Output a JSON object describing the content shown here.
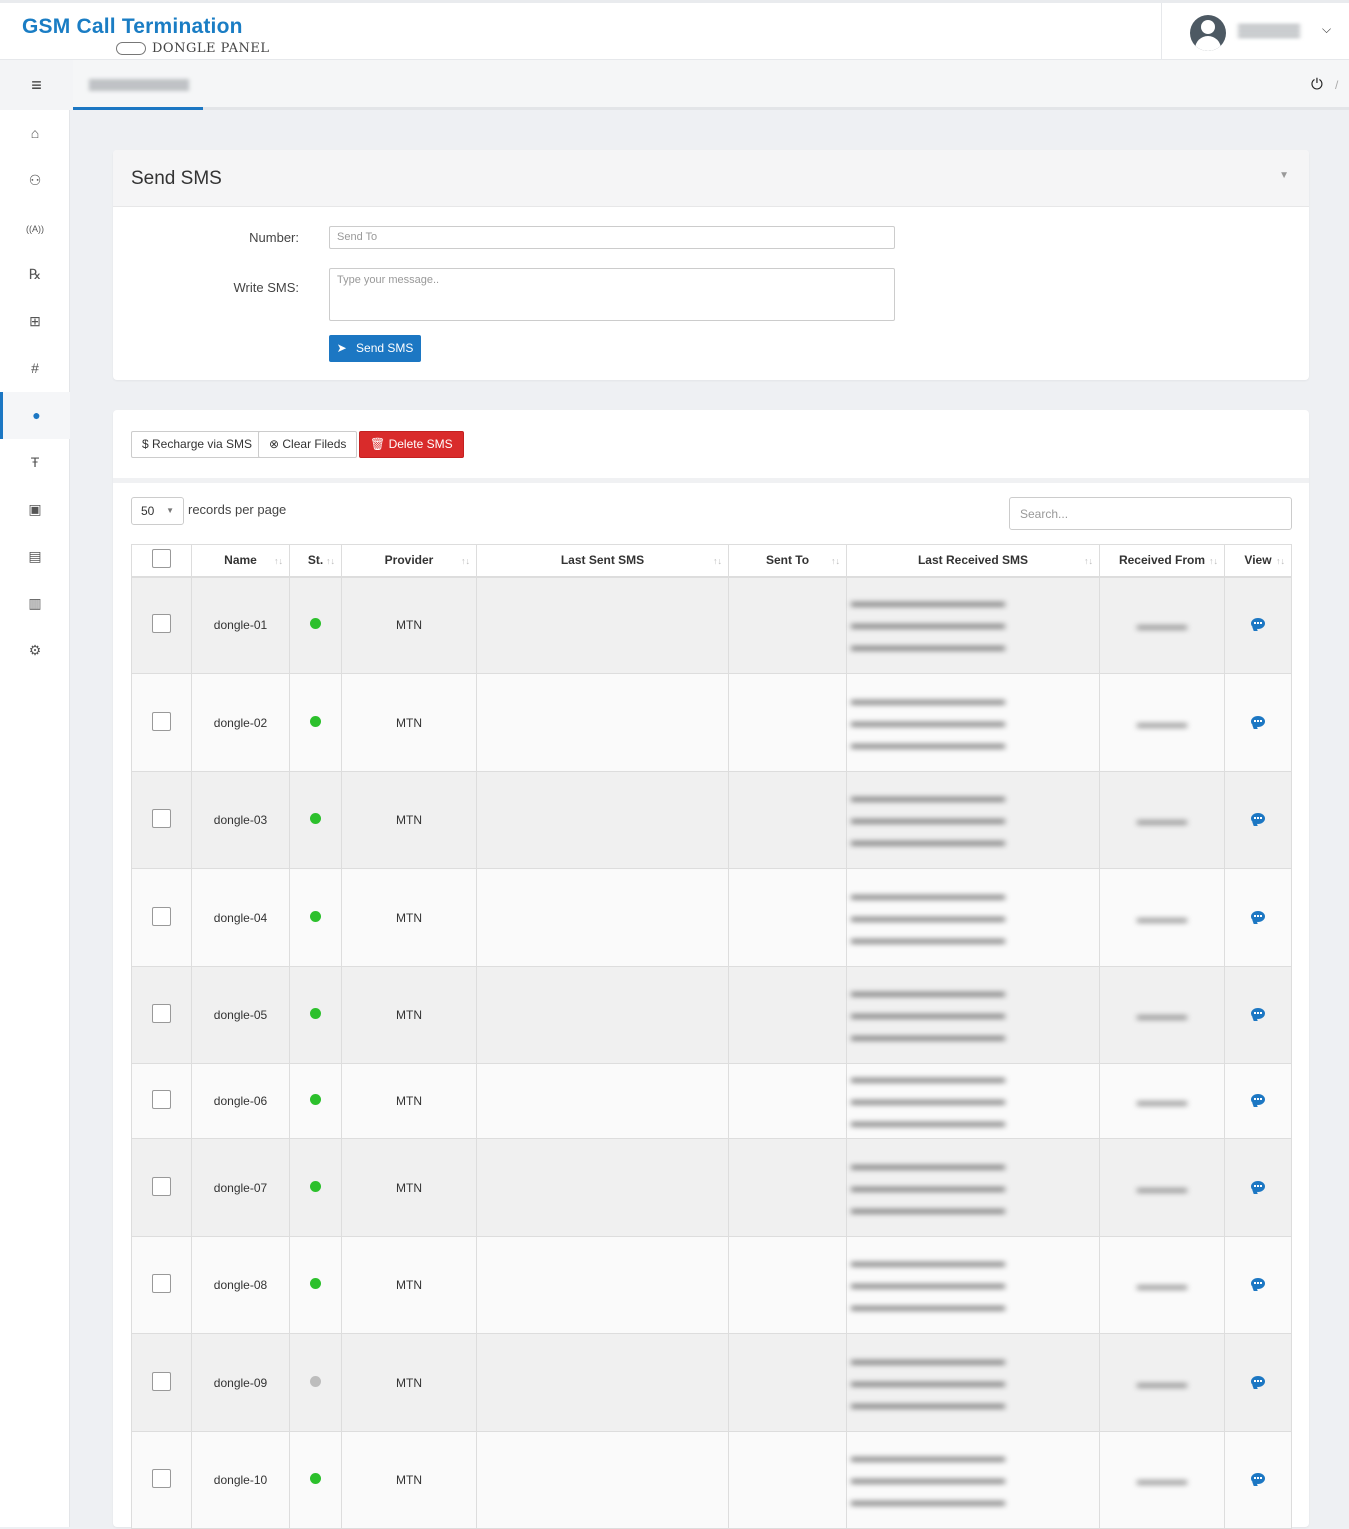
{
  "app": {
    "title": "GSM Call Termination",
    "subtitle": "DONGLE PANEL"
  },
  "header": {
    "user_menu_caret": "⌄",
    "logout_icon": "power-icon"
  },
  "sidebar": {
    "items": [
      {
        "icon": "home-icon",
        "glyph": "⌂"
      },
      {
        "icon": "users-icon",
        "glyph": "⚇"
      },
      {
        "icon": "antenna-icon",
        "glyph": "((A))"
      },
      {
        "icon": "prescription-icon",
        "glyph": "℞"
      },
      {
        "icon": "network-icon",
        "glyph": "⊞"
      },
      {
        "icon": "hash-icon",
        "glyph": "#"
      },
      {
        "icon": "sms-icon",
        "glyph": "●",
        "active": true
      },
      {
        "icon": "text-icon",
        "glyph": "Ŧ"
      },
      {
        "icon": "edit-icon",
        "glyph": "▣"
      },
      {
        "icon": "table-icon",
        "glyph": "▤"
      },
      {
        "icon": "chart-icon",
        "glyph": "▥"
      },
      {
        "icon": "settings-icon",
        "glyph": "⚙"
      }
    ]
  },
  "send_sms": {
    "title": "Send SMS",
    "number_label": "Number:",
    "number_placeholder": "Send To",
    "message_label": "Write SMS:",
    "message_placeholder": "Type your message..",
    "send_button": "Send SMS"
  },
  "toolbar": {
    "recharge": "$ Recharge via SMS",
    "clear": "⊗ Clear Fileds",
    "delete": "🗑 Delete SMS"
  },
  "list": {
    "per_page": "50",
    "per_page_label": "records per page",
    "search_placeholder": "Search..."
  },
  "table": {
    "columns": [
      "",
      "Name",
      "St.",
      "Provider",
      "Last Sent SMS",
      "Sent To",
      "Last Received SMS",
      "Received From",
      "View"
    ],
    "status_colors": {
      "online": "#2cc02c",
      "offline": "#bdbdbd"
    },
    "rows": [
      {
        "name": "dongle-01",
        "status": "online",
        "provider": "MTN"
      },
      {
        "name": "dongle-02",
        "status": "online",
        "provider": "MTN"
      },
      {
        "name": "dongle-03",
        "status": "online",
        "provider": "MTN"
      },
      {
        "name": "dongle-04",
        "status": "online",
        "provider": "MTN"
      },
      {
        "name": "dongle-05",
        "status": "online",
        "provider": "MTN"
      },
      {
        "name": "dongle-06",
        "status": "online",
        "provider": "MTN"
      },
      {
        "name": "dongle-07",
        "status": "online",
        "provider": "MTN"
      },
      {
        "name": "dongle-08",
        "status": "online",
        "provider": "MTN"
      },
      {
        "name": "dongle-09",
        "status": "offline",
        "provider": "MTN"
      },
      {
        "name": "dongle-10",
        "status": "online",
        "provider": "MTN"
      }
    ]
  }
}
